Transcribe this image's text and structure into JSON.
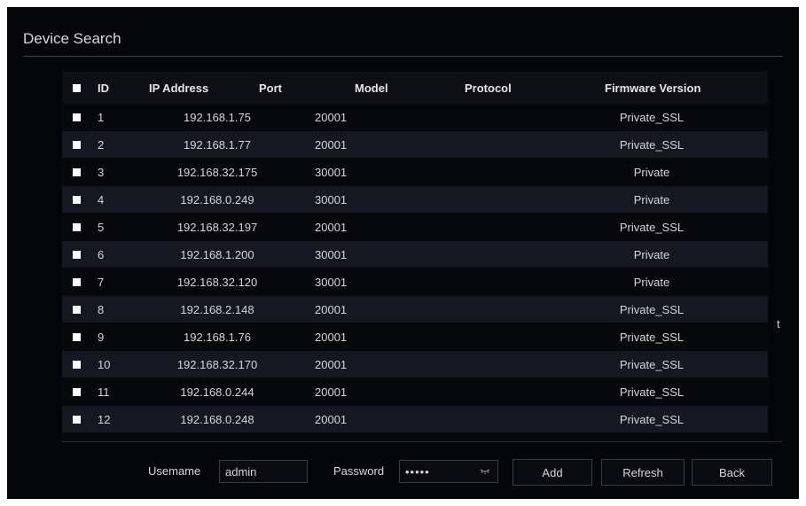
{
  "dialog": {
    "title": "Device Search"
  },
  "table": {
    "headers": {
      "id": "ID",
      "ip": "IP Address",
      "port": "Port",
      "model": "Model",
      "protocol": "Protocol",
      "firmware": "Firmware Version"
    },
    "rows": [
      {
        "id": "1",
        "ip": "192.168.1.75",
        "port": "20001",
        "model": "",
        "protocol": "Private_SSL",
        "firmware": ""
      },
      {
        "id": "2",
        "ip": "192.168.1.77",
        "port": "20001",
        "model": "",
        "protocol": "Private_SSL",
        "firmware": ""
      },
      {
        "id": "3",
        "ip": "192.168.32.175",
        "port": "30001",
        "model": "",
        "protocol": "Private",
        "firmware": ""
      },
      {
        "id": "4",
        "ip": "192.168.0.249",
        "port": "30001",
        "model": "",
        "protocol": "Private",
        "firmware": ""
      },
      {
        "id": "5",
        "ip": "192.168.32.197",
        "port": "20001",
        "model": "",
        "protocol": "Private_SSL",
        "firmware": ""
      },
      {
        "id": "6",
        "ip": "192.168.1.200",
        "port": "30001",
        "model": "",
        "protocol": "Private",
        "firmware": ""
      },
      {
        "id": "7",
        "ip": "192.168.32.120",
        "port": "30001",
        "model": "",
        "protocol": "Private",
        "firmware": ""
      },
      {
        "id": "8",
        "ip": "192.168.2.148",
        "port": "20001",
        "model": "",
        "protocol": "Private_SSL",
        "firmware": "t"
      },
      {
        "id": "9",
        "ip": "192.168.1.76",
        "port": "20001",
        "model": "",
        "protocol": "Private_SSL",
        "firmware": ""
      },
      {
        "id": "10",
        "ip": "192.168.32.170",
        "port": "20001",
        "model": "",
        "protocol": "Private_SSL",
        "firmware": ""
      },
      {
        "id": "11",
        "ip": "192.168.0.244",
        "port": "20001",
        "model": "",
        "protocol": "Private_SSL",
        "firmware": ""
      },
      {
        "id": "12",
        "ip": "192.168.0.248",
        "port": "20001",
        "model": "",
        "protocol": "Private_SSL",
        "firmware": ""
      }
    ]
  },
  "login": {
    "username_label": "Usemame",
    "username_value": "admin",
    "password_label": "Password",
    "password_value": "•••••"
  },
  "buttons": {
    "add": "Add",
    "refresh": "Refresh",
    "back": "Back"
  },
  "colors": {
    "background": "#05060a",
    "row_alt": "#151821",
    "text": "#d6d6d6",
    "checkbox": "#ffffff"
  },
  "icons": {
    "password_toggle": "eye-closed-icon"
  }
}
